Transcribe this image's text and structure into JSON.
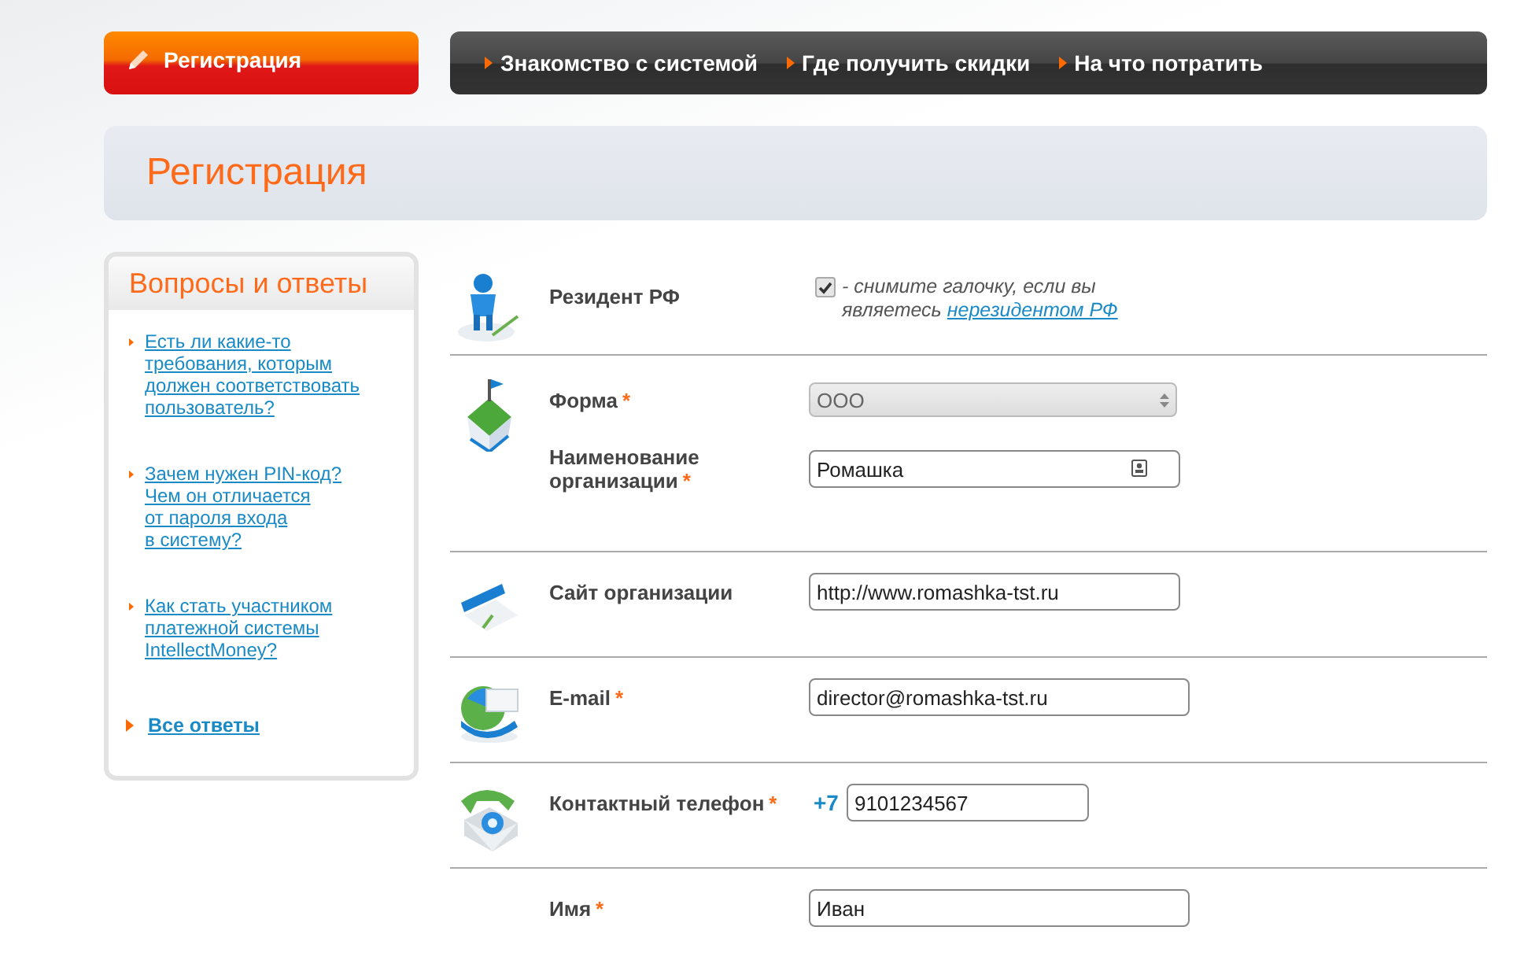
{
  "top_nav": {
    "active": {
      "label": "Регистрация",
      "selected": true
    },
    "items": [
      {
        "label": "Знакомство с системой",
        "selected": false
      },
      {
        "label": "Где получить скидки",
        "selected": false
      },
      {
        "label": "На что потратить",
        "selected": false
      }
    ]
  },
  "page_title": "Регистрация",
  "sidebar": {
    "title": "Вопросы и ответы",
    "questions": [
      {
        "text": "Есть ли какие-то требования, которым должен соответствовать пользователь?"
      },
      {
        "text": "Зачем нужен PIN-код?\nЧем он отличается\nот пароля входа\nв систему?"
      },
      {
        "text": "Как стать участником платежной системы IntellectMoney?"
      }
    ],
    "all_link": "Все ответы"
  },
  "form": {
    "sections": [
      {
        "fields": [
          {
            "kind": "checkbox",
            "label": "Резидент РФ",
            "checked": true,
            "note": "- снимите галочку, если вы являетесь ",
            "note_link": "нерезидентом РФ"
          }
        ]
      },
      {
        "fields": [
          {
            "kind": "select",
            "label": "Форма",
            "required_mark": "*",
            "value": "ООО",
            "disabled": true
          },
          {
            "kind": "text",
            "label": "Наименование организации",
            "required_mark": "*",
            "value": "Ромашка",
            "contact_icon": true
          }
        ]
      },
      {
        "fields": [
          {
            "kind": "text",
            "label": "Сайт организации",
            "value": "http://www.romashka-tst.ru"
          }
        ]
      },
      {
        "fields": [
          {
            "kind": "text",
            "label": "E-mail",
            "required_mark": "*",
            "value": "director@romashka-tst.ru"
          }
        ]
      },
      {
        "fields": [
          {
            "kind": "phone",
            "label": "Контактный телефон",
            "required_mark": "*",
            "prefix": "+7",
            "value": "9101234567"
          }
        ]
      },
      {
        "fields": [
          {
            "kind": "text",
            "label": "Имя",
            "required_mark": "*",
            "value": "Иван"
          }
        ]
      }
    ]
  }
}
